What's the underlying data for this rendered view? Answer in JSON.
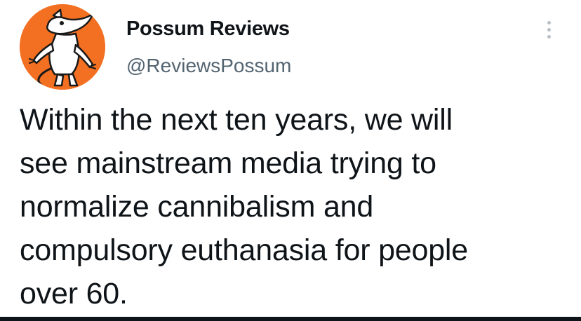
{
  "tweet": {
    "author": {
      "display_name": "Possum Reviews",
      "handle": "@ReviewsPossum",
      "avatar_icon": "possum-avatar-icon",
      "avatar_color": "#f36f21"
    },
    "more_icon": "vertical-ellipsis-icon",
    "text": "Within the next ten years, we will\nsee mainstream media trying to\nnormalize cannibalism and\ncompulsory euthanasia for people\nover 60."
  },
  "colors": {
    "primary_text": "#0f1419",
    "secondary_text": "#536471",
    "background": "#ffffff"
  }
}
